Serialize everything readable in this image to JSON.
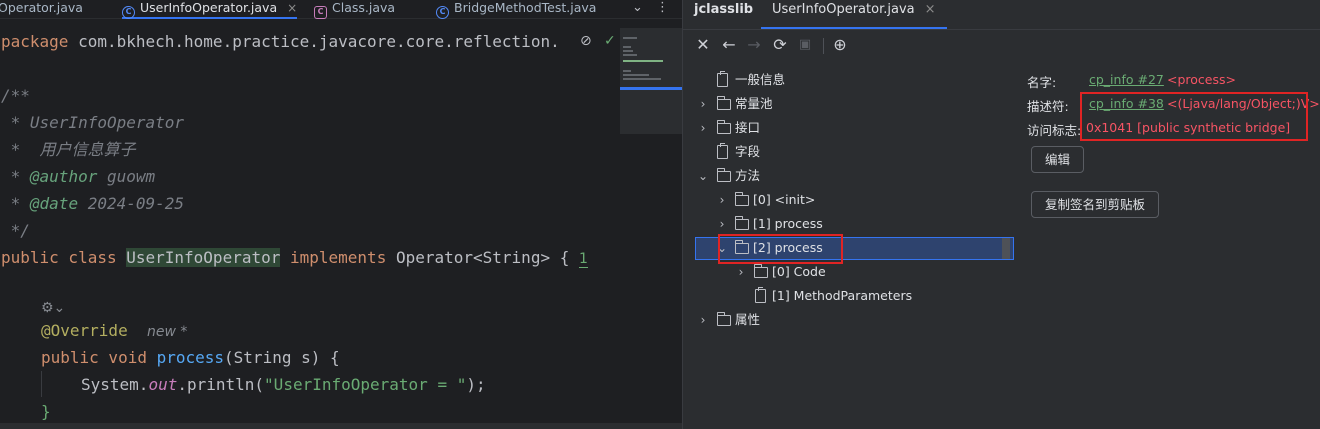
{
  "editor": {
    "tabs": [
      {
        "label": "Operator.java",
        "icon": "interface-icon",
        "active": false
      },
      {
        "label": "UserInfoOperator.java",
        "icon": "class-icon",
        "active": true
      },
      {
        "label": "Class.java",
        "icon": "class-file-icon",
        "active": false
      },
      {
        "label": "BridgeMethodTest.java",
        "icon": "class-icon",
        "active": false
      }
    ],
    "tab_close": "×",
    "code": {
      "package_kw": "package",
      "package_name": " com.bkhech.home.practice.javacore.core.reflection.",
      "doc_open": "/**",
      "doc_class": " * UserInfoOperator",
      "doc_desc": " *  用户信息算子",
      "doc_author_prefix": " * ",
      "doc_author_tag": "@author",
      "doc_author_val": " guowm",
      "doc_date_prefix": " * ",
      "doc_date_tag": "@date",
      "doc_date_val": " 2024-09-25",
      "doc_close": " */",
      "cls_kw1": "public class ",
      "cls_name": "UserInfoOperator",
      "cls_kw2": " implements ",
      "cls_rest": "Operator<String> {",
      "cls_problems": "1",
      "override": "@Override",
      "override_hint": "new *",
      "method_kw": "public void ",
      "method_name": "process",
      "method_params": "(String s) {",
      "println_pre": "System.",
      "println_field": "out",
      "println_mid": ".println(",
      "println_str": "\"UserInfoOperator = \"",
      "println_end": ");",
      "close_brace": "}"
    }
  },
  "jclasslib": {
    "title": "jclasslib",
    "file_tab": "UserInfoOperator.java",
    "toolbar": [
      "close-icon",
      "back-arrow-icon",
      "forward-arrow-icon",
      "refresh-icon",
      "save-icon",
      "web-icon"
    ],
    "tree": {
      "general": "一般信息",
      "constant_pool": "常量池",
      "interfaces": "接口",
      "fields": "字段",
      "methods": "方法",
      "method_items": [
        "[0] <init>",
        "[1] process",
        "[2] process"
      ],
      "selected_children": [
        "[0] Code",
        "[1] MethodParameters"
      ],
      "attributes": "属性"
    },
    "details": {
      "name_label": "名字:",
      "name_link": "cp_info #27",
      "name_value": "<process>",
      "descriptor_label": "描述符:",
      "descriptor_link": "cp_info #38",
      "descriptor_value": "<(Ljava/lang/Object;)V>",
      "access_label": "访问标志:",
      "access_value": "0x1041 [public synthetic bridge]",
      "edit_button": "编辑",
      "copy_button": "复制签名到剪贴板"
    }
  },
  "colors": {
    "highlight_box": "#e02424",
    "selection": "#2e436e",
    "link": "#6aab73",
    "value": "#f75464"
  }
}
